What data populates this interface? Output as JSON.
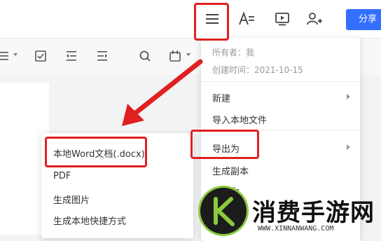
{
  "header": {
    "icons": [
      "menu-icon",
      "text-format-icon",
      "present-icon",
      "add-user-icon"
    ],
    "share_label": "分享",
    "accent_color": "#3370ff"
  },
  "toolbar": {
    "icons": [
      "list-icon",
      "checkbox-icon",
      "outdent-icon",
      "indent-icon",
      "search-icon",
      "calendar-icon"
    ]
  },
  "menu": {
    "owner": "所有者：我",
    "created": "创建时间：2021-10-15",
    "items": [
      "新建",
      "导入本地文件",
      "导出为",
      "生成副本",
      "另存为"
    ]
  },
  "submenu": {
    "items": [
      "本地Word文档(.docx)",
      "PDF",
      "生成图片",
      "生成本地快捷方式"
    ]
  },
  "highlight_color": "#e02020",
  "watermark": {
    "text": "消费手游网",
    "url": "WWW.XINNANWANG.COM",
    "logo_letter": "K"
  }
}
